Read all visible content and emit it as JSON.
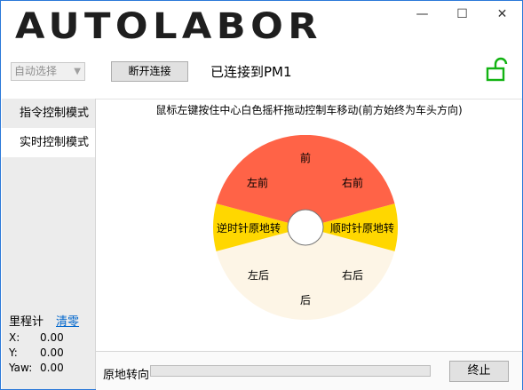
{
  "app": {
    "logo_text": "AUTOLABOR"
  },
  "window_controls": {
    "minimize": "—",
    "maximize": "☐",
    "close": "✕"
  },
  "connection": {
    "port_select_value": "自动选择",
    "disconnect_label": "断开连接",
    "status_text": "已连接到PM1"
  },
  "sidebar": {
    "items": [
      {
        "label": "指令控制模式",
        "active": false
      },
      {
        "label": "实时控制模式",
        "active": true
      }
    ]
  },
  "odometer": {
    "title": "里程计",
    "clear_label": "清零",
    "rows": [
      {
        "key": "X:",
        "value": "0.00"
      },
      {
        "key": "Y:",
        "value": "0.00"
      },
      {
        "key": "Yaw:",
        "value": "0.00"
      }
    ]
  },
  "main": {
    "instruction": "鼠标左键按住中心白色摇杆拖动控制车移动(前方始终为车头方向)",
    "wheel": {
      "front": "前",
      "front_left": "左前",
      "front_right": "右前",
      "ccw": "逆时针原地转",
      "cw": "顺时针原地转",
      "back_left": "左后",
      "back_right": "右后",
      "back": "后"
    },
    "colors": {
      "front": "#ff6347",
      "rotate": "#ffd700",
      "back": "#fdf5e6"
    }
  },
  "bottom": {
    "rotate_label": "原地转向",
    "progress": 0,
    "stop_label": "终止"
  }
}
